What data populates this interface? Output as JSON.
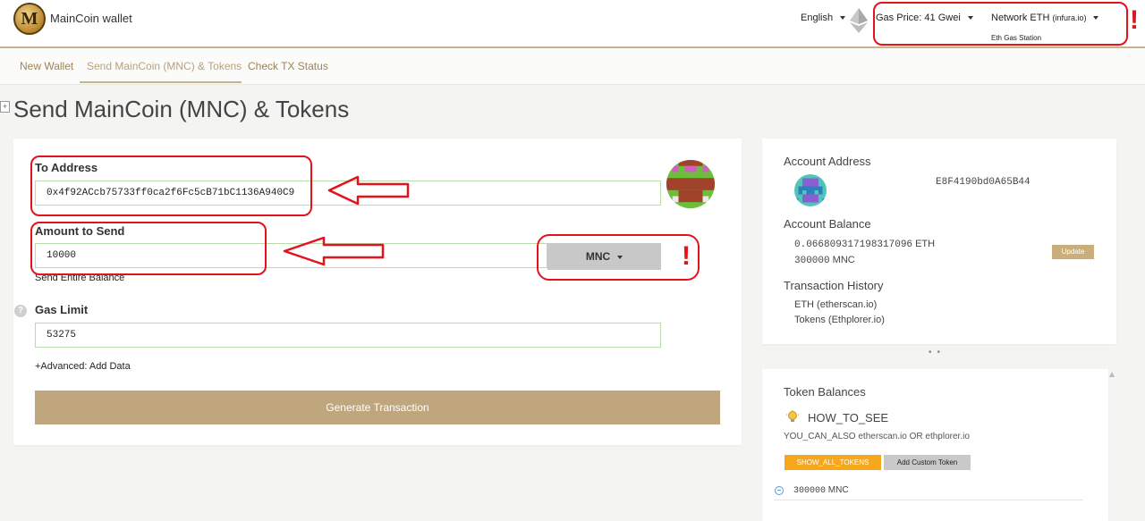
{
  "header": {
    "brand": "MainCoin wallet",
    "logo_letter": "M",
    "language": "English",
    "gas_price": "Gas Price: 41 Gwei",
    "network_label": "Network ETH",
    "network_provider": "(infura.io)",
    "gas_station": "Eth Gas Station"
  },
  "nav": {
    "items": [
      "New Wallet",
      "Send MainCoin (MNC) & Tokens",
      "Check TX Status"
    ]
  },
  "page_title": "Send MainCoin (MNC) & Tokens",
  "form": {
    "to_address_label": "To Address",
    "to_address_value": "0x4f92ACcb75733ff0ca2f6Fc5cB71bC1136A940C9",
    "amount_label": "Amount to Send",
    "amount_value": "10000",
    "currency": "MNC",
    "send_entire_balance": "Send Entire Balance",
    "gas_limit_label": "Gas Limit",
    "gas_limit_value": "53275",
    "advanced": "+Advanced: Add Data",
    "generate_button": "Generate Transaction",
    "help_icon_glyph": "?"
  },
  "sidebar": {
    "account_address_label": "Account Address",
    "account_address_value": "E8F4190bd0A65B44",
    "account_balance_label": "Account Balance",
    "eth_balance": "0.066809317198317096",
    "eth_unit": "ETH",
    "mnc_balance": "300000",
    "mnc_unit": "MNC",
    "update_button": "Update",
    "tx_history_label": "Transaction History",
    "tx_eth": "ETH (etherscan.io)",
    "tx_tokens": "Tokens (Ethplorer.io)"
  },
  "tokens": {
    "title": "Token Balances",
    "how_to_see": "HOW_TO_SEE",
    "hint": "YOU_CAN_ALSO etherscan.io OR ethplorer.io",
    "show_all": "SHOW_ALL_TOKENS",
    "add_custom": "Add Custom Token",
    "token_amount": "300000",
    "token_unit": "MNC"
  },
  "annotations": {
    "exclamation": "!",
    "color": "#e3121b"
  }
}
